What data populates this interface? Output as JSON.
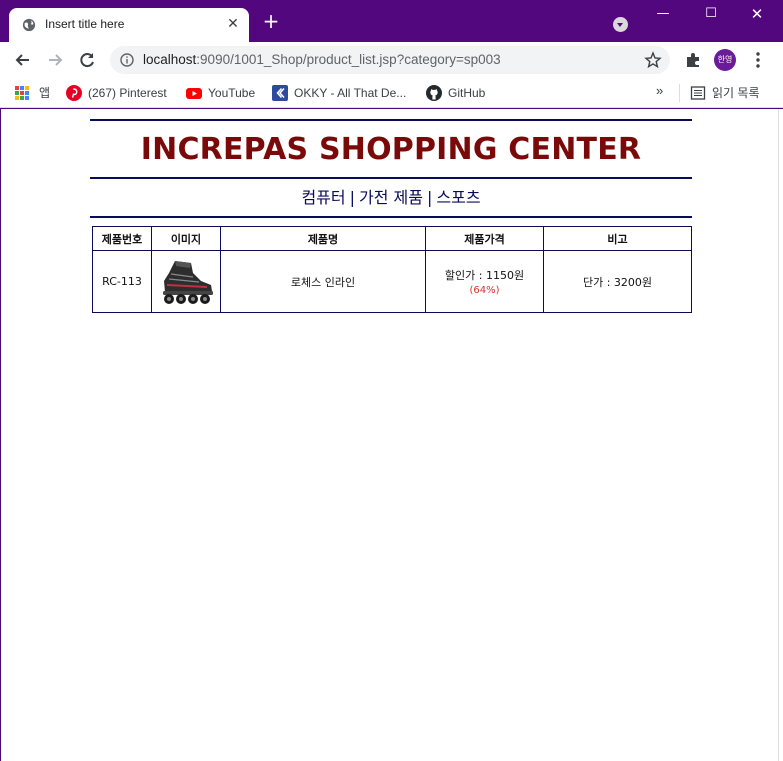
{
  "browser": {
    "tab_title": "Insert title here",
    "new_tab_label": "+",
    "address": {
      "host": "localhost",
      "path": ":9090/1001_Shop/product_list.jsp?category=sp003"
    },
    "profile_label": "한영",
    "bookmarks": [
      {
        "label": "앱",
        "icon": "apps-grid-icon"
      },
      {
        "label": "(267) Pinterest",
        "icon": "pinterest-icon"
      },
      {
        "label": "YouTube",
        "icon": "youtube-icon"
      },
      {
        "label": "OKKY - All That De...",
        "icon": "okky-icon"
      },
      {
        "label": "GitHub",
        "icon": "github-icon"
      }
    ],
    "more_bookmarks": "»",
    "reading_list": "읽기 목록",
    "colors": {
      "frame": "#53077f",
      "accent": "#6a1b9a"
    }
  },
  "page": {
    "heading": "INCREPAS SHOPPING CENTER",
    "categories": [
      "컴퓨터",
      "가전 제품",
      "스포츠"
    ],
    "separator": "|",
    "table": {
      "headers": [
        "제품번호",
        "이미지",
        "제품명",
        "제품가격",
        "비고"
      ],
      "rows": [
        {
          "id": "RC-113",
          "image": "inline-skate-image",
          "name": "로체스 인라인",
          "sale_price": "할인가 : 1150원",
          "discount": "(64%)",
          "note": "단가 : 3200원"
        }
      ]
    },
    "colors": {
      "heading": "#7a0a0a",
      "rule": "#0b0b5c",
      "discount": "#d0342c"
    }
  }
}
